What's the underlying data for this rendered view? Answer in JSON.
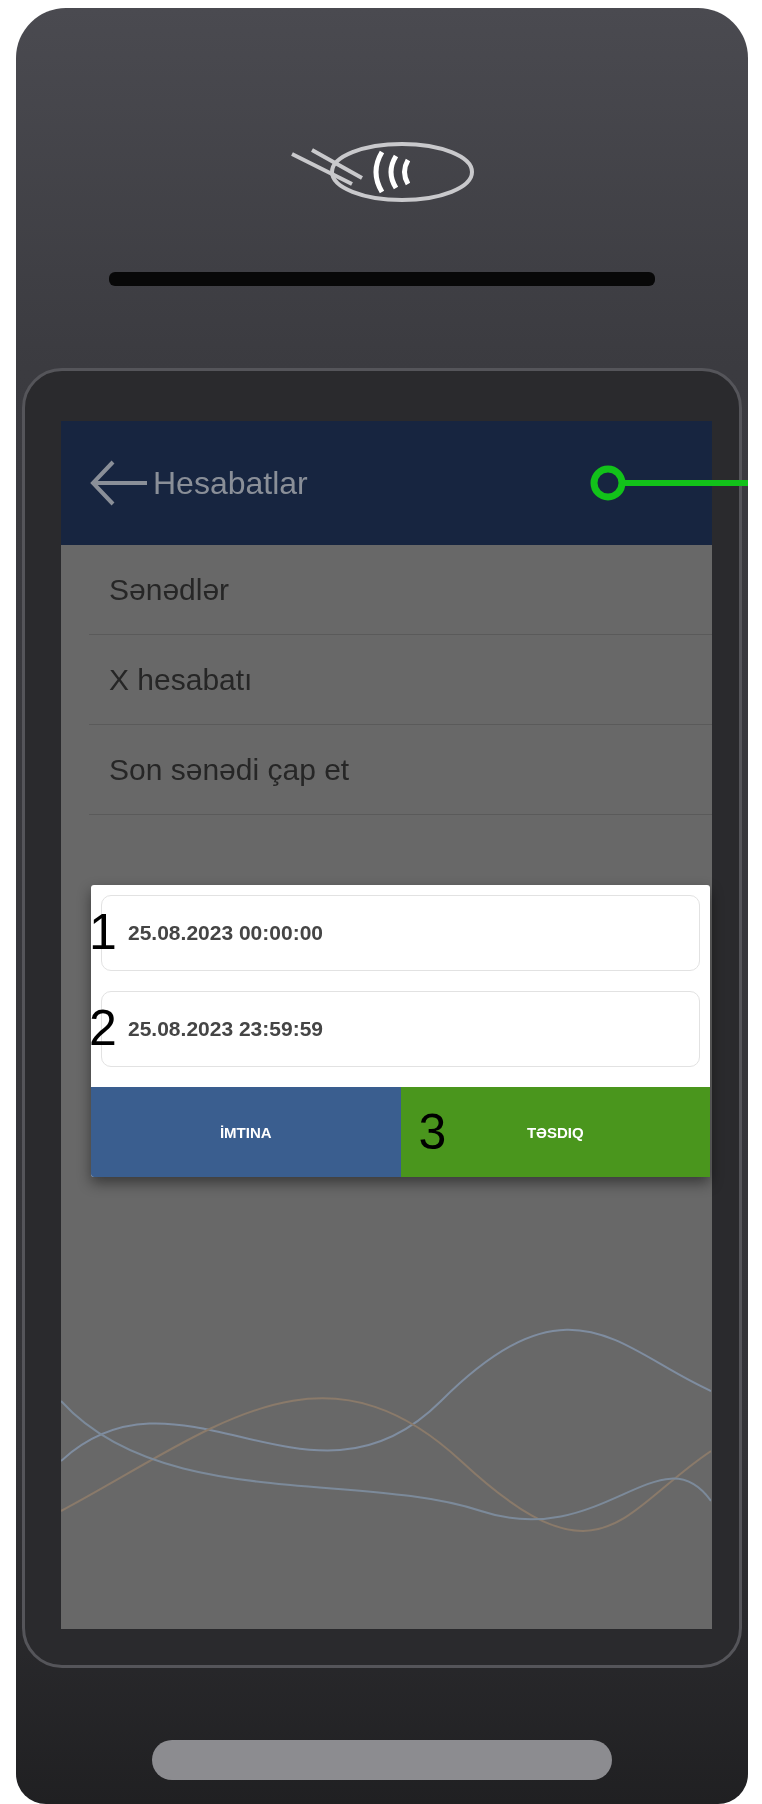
{
  "header": {
    "title": "Hesabatlar"
  },
  "menu": [
    {
      "label": "Sənədlər"
    },
    {
      "label": "X hesabatı"
    },
    {
      "label": "Son sənədi çap et"
    }
  ],
  "dialog": {
    "fields": [
      {
        "value": "25.08.2023 00:00:00",
        "callout": "1"
      },
      {
        "value": "25.08.2023 23:59:59",
        "callout": "2"
      }
    ],
    "buttons": [
      {
        "label": "İMTINA",
        "kind": "cancel"
      },
      {
        "label": "TƏSDIQ",
        "kind": "confirm",
        "callout": "3"
      }
    ]
  }
}
